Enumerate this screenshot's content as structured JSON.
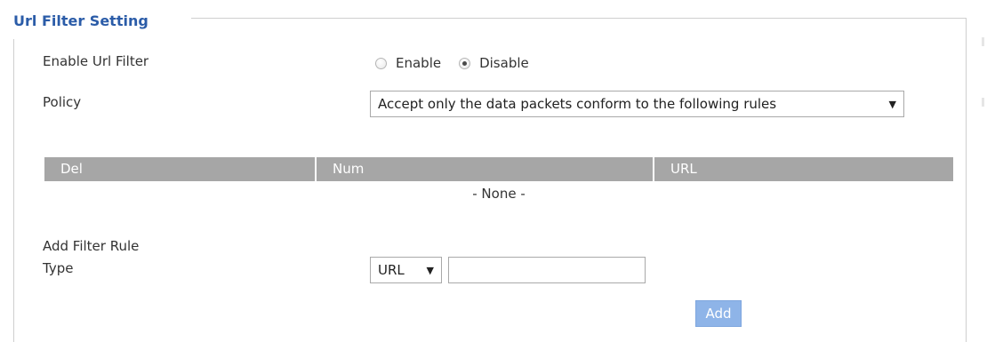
{
  "section": {
    "legend": "Url Filter Setting"
  },
  "enable_filter": {
    "label": "Enable Url Filter",
    "options": [
      "Enable",
      "Disable"
    ],
    "selected": "Disable"
  },
  "policy": {
    "label": "Policy",
    "selected": "Accept only the data packets conform to the following rules"
  },
  "rules_table": {
    "columns": [
      "Del",
      "Num",
      "URL"
    ],
    "empty_text": "- None -"
  },
  "add_rule": {
    "heading": "Add Filter Rule",
    "type_label": "Type",
    "type_selected": "URL",
    "value": "",
    "add_label": "Add"
  },
  "colors": {
    "legend": "#2b5ca8",
    "table_header_bg": "#a6a6a6",
    "add_button_bg": "#8eb4e8"
  }
}
